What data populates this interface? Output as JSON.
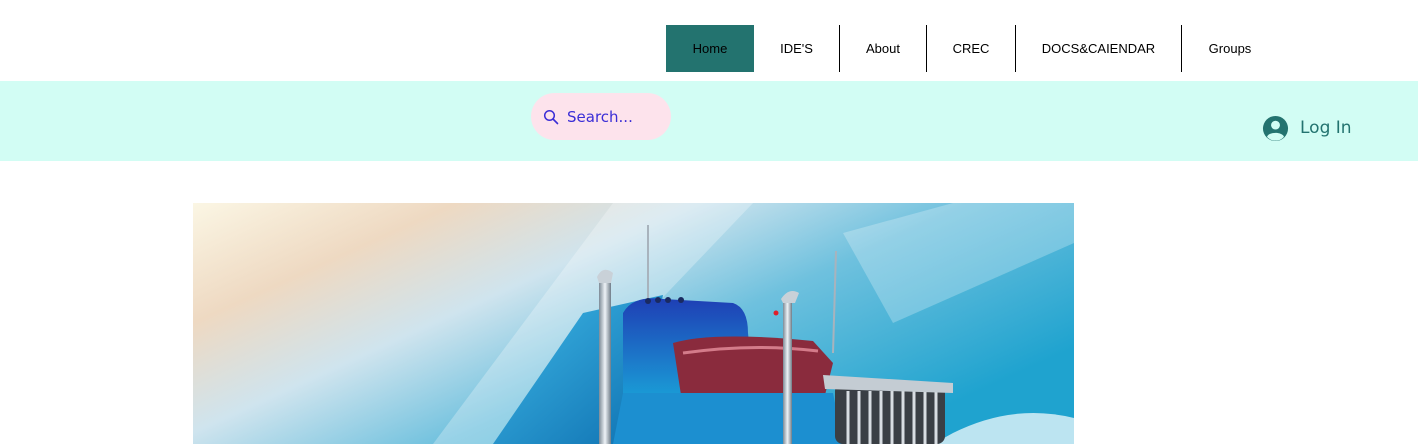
{
  "nav": {
    "items": [
      {
        "label": "Home",
        "active": true
      },
      {
        "label": "IDE'S",
        "active": false
      },
      {
        "label": "About",
        "active": false
      },
      {
        "label": "CREC",
        "active": false
      },
      {
        "label": "DOCS&CAIENDAR",
        "active": false
      },
      {
        "label": "Groups",
        "active": false
      }
    ]
  },
  "search": {
    "placeholder": "Search...",
    "icon": "search-icon"
  },
  "login": {
    "label": "Log In",
    "icon": "user-avatar-icon"
  },
  "hero": {
    "icon": "truck-illustration"
  },
  "colors": {
    "accent": "#23736f",
    "bar_background": "#d2fdf4",
    "search_background": "#fde3ec",
    "search_text": "#3a2dd6"
  }
}
